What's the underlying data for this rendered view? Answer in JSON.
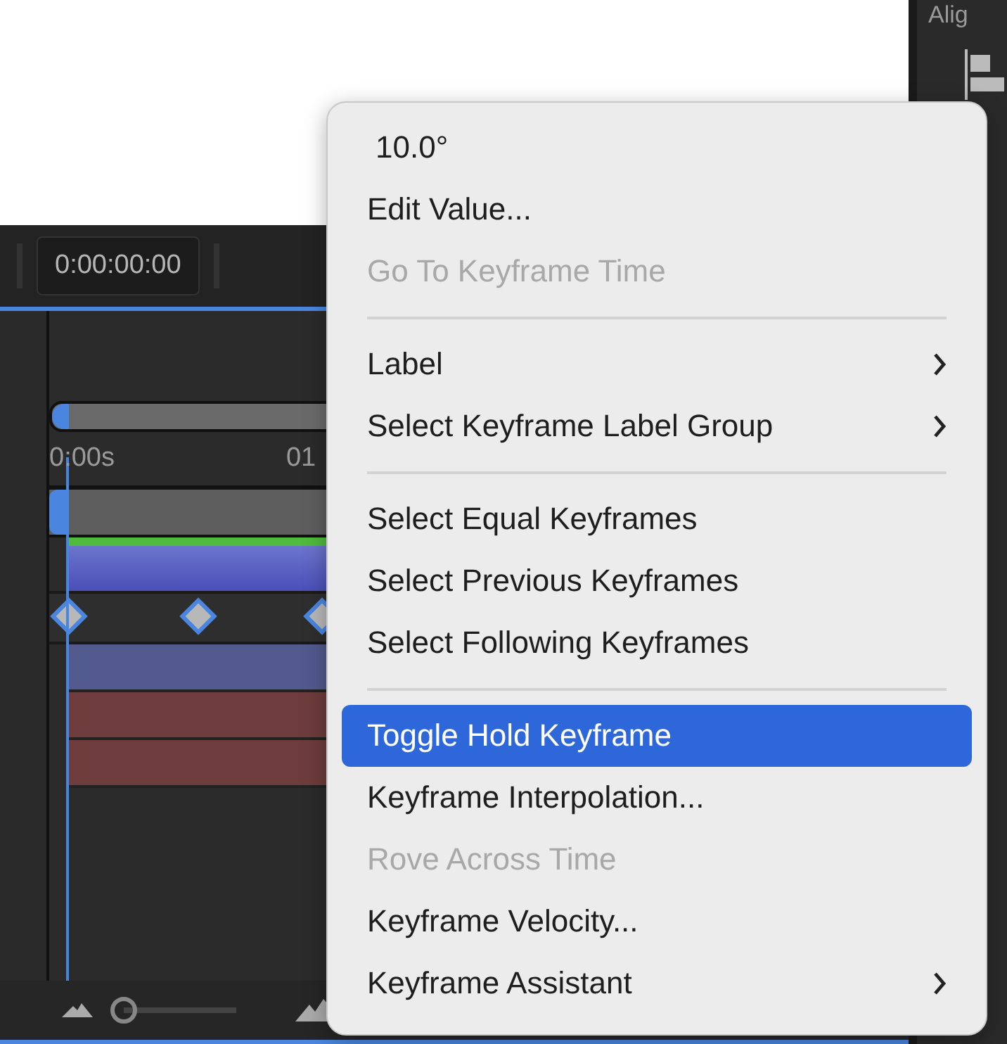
{
  "timeline": {
    "timecode": "0:00:00:00",
    "ruler_labels": [
      "0:00s",
      "01"
    ],
    "zoom": {
      "level": 0
    }
  },
  "side_panel": {
    "title": "Alig"
  },
  "context_menu": {
    "items": [
      {
        "kind": "value",
        "label": "10.0°"
      },
      {
        "kind": "item",
        "label": "Edit Value...",
        "disabled": false,
        "selected": false,
        "submenu": false
      },
      {
        "kind": "item",
        "label": "Go To Keyframe Time",
        "disabled": true,
        "selected": false,
        "submenu": false
      },
      {
        "kind": "separator"
      },
      {
        "kind": "item",
        "label": "Label",
        "disabled": false,
        "selected": false,
        "submenu": true
      },
      {
        "kind": "item",
        "label": "Select Keyframe Label Group",
        "disabled": false,
        "selected": false,
        "submenu": true
      },
      {
        "kind": "separator"
      },
      {
        "kind": "item",
        "label": "Select Equal Keyframes",
        "disabled": false,
        "selected": false,
        "submenu": false
      },
      {
        "kind": "item",
        "label": "Select Previous Keyframes",
        "disabled": false,
        "selected": false,
        "submenu": false
      },
      {
        "kind": "item",
        "label": "Select Following Keyframes",
        "disabled": false,
        "selected": false,
        "submenu": false
      },
      {
        "kind": "separator"
      },
      {
        "kind": "item",
        "label": "Toggle Hold Keyframe",
        "disabled": false,
        "selected": true,
        "submenu": false
      },
      {
        "kind": "item",
        "label": "Keyframe Interpolation...",
        "disabled": false,
        "selected": false,
        "submenu": false
      },
      {
        "kind": "item",
        "label": "Rove Across Time",
        "disabled": true,
        "selected": false,
        "submenu": false
      },
      {
        "kind": "item",
        "label": "Keyframe Velocity...",
        "disabled": false,
        "selected": false,
        "submenu": false
      },
      {
        "kind": "item",
        "label": "Keyframe Assistant",
        "disabled": false,
        "selected": false,
        "submenu": true
      }
    ]
  }
}
